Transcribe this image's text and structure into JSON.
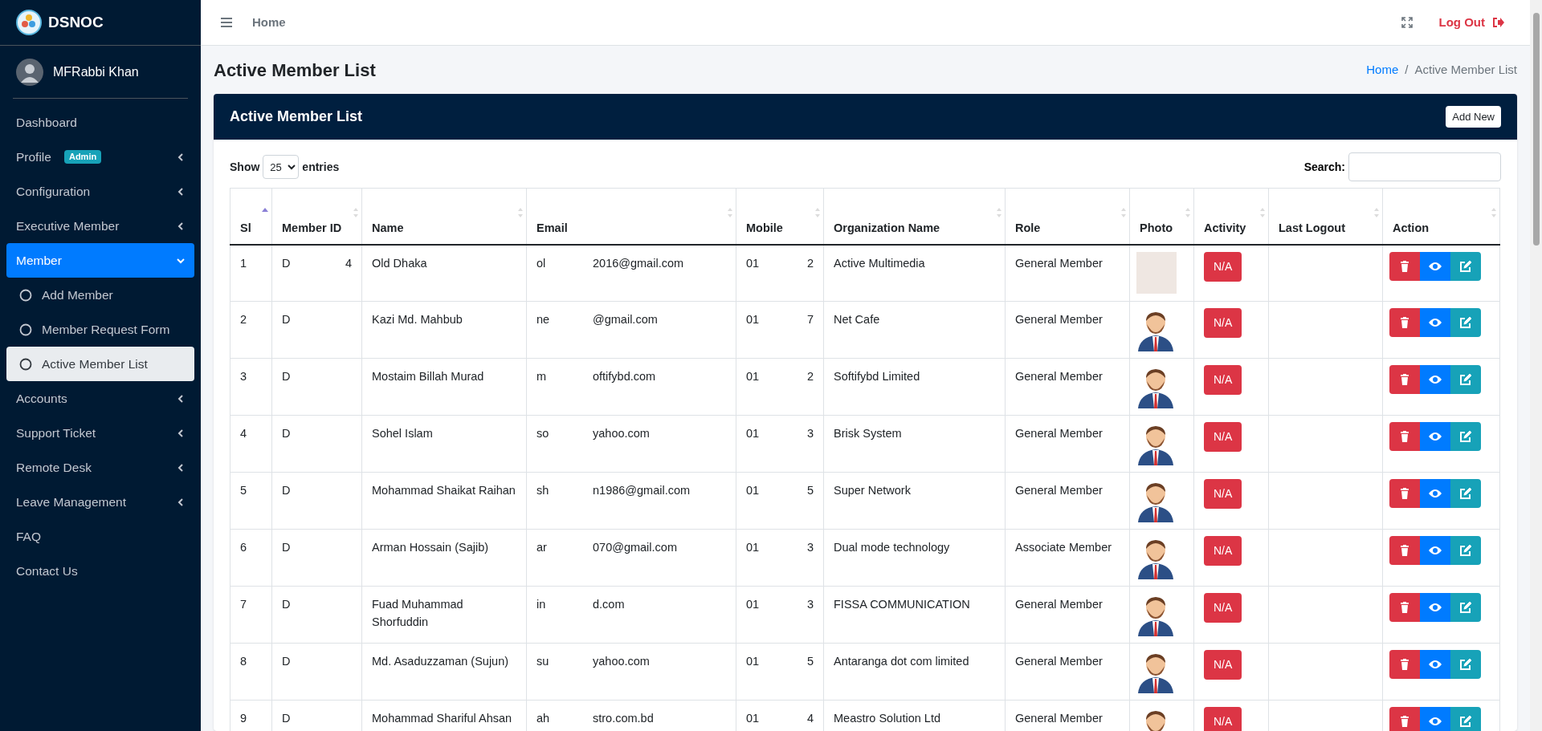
{
  "brand": {
    "name": "DSNOC"
  },
  "user": {
    "name": "MFRabbi Khan"
  },
  "sidebar": {
    "items": [
      {
        "label": "Dashboard",
        "kind": "link",
        "selected": false
      },
      {
        "label": "Profile",
        "kind": "menu",
        "badge": "Admin",
        "expanded": false,
        "selected": false
      },
      {
        "label": "Configuration",
        "kind": "menu",
        "expanded": false,
        "selected": false
      },
      {
        "label": "Executive Member",
        "kind": "menu",
        "expanded": false,
        "selected": false
      },
      {
        "label": "Member",
        "kind": "menu",
        "expanded": true,
        "selected": true,
        "children": [
          {
            "label": "Add Member",
            "selected": false
          },
          {
            "label": "Member Request Form",
            "selected": false
          },
          {
            "label": "Active Member List",
            "selected": true
          }
        ]
      },
      {
        "label": "Accounts",
        "kind": "menu",
        "expanded": false,
        "selected": false
      },
      {
        "label": "Support Ticket",
        "kind": "menu",
        "expanded": false,
        "selected": false
      },
      {
        "label": "Remote Desk",
        "kind": "menu",
        "expanded": false,
        "selected": false
      },
      {
        "label": "Leave Management",
        "kind": "menu",
        "expanded": false,
        "selected": false
      },
      {
        "label": "FAQ",
        "kind": "link",
        "selected": false
      },
      {
        "label": "Contact Us",
        "kind": "link",
        "selected": false
      }
    ]
  },
  "navbar": {
    "home": "Home",
    "logout": "Log Out"
  },
  "page": {
    "title": "Active Member List",
    "breadcrumb": [
      {
        "label": "Home",
        "kind": "link"
      },
      {
        "label": "Active Member List",
        "kind": "current"
      }
    ],
    "breadcrumb_separator": "/"
  },
  "card": {
    "title": "Active Member List",
    "add_button": "Add New",
    "show_label": "Show",
    "page_size": "25",
    "entries_label": "entries",
    "search_label": "Search:",
    "table": {
      "columns": [
        {
          "label": "Sl",
          "sorted": true
        },
        {
          "label": "Member ID",
          "sorted": false
        },
        {
          "label": "Name",
          "sorted": false
        },
        {
          "label": "Email",
          "sorted": false
        },
        {
          "label": "Mobile",
          "sorted": false
        },
        {
          "label": "Organization Name",
          "sorted": false
        },
        {
          "label": "Role",
          "sorted": false
        },
        {
          "label": "Photo",
          "sorted": false
        },
        {
          "label": "Activity",
          "sorted": false
        },
        {
          "label": "Last Logout",
          "sorted": false
        },
        {
          "label": "Action",
          "sorted": false
        }
      ],
      "rows": [
        {
          "sl": "1",
          "member_id": [
            "D",
            "4"
          ],
          "name": "Old Dhaka",
          "email": [
            "ol",
            "2016@gmail.com"
          ],
          "mobile": [
            "01",
            "2"
          ],
          "organization": "Active Multimedia",
          "role": "General Member",
          "kind": "photo",
          "activity": "N/A"
        },
        {
          "sl": "2",
          "member_id": [
            "D"
          ],
          "name": "Kazi Md. Mahbub",
          "email": [
            "ne",
            "@gmail.com"
          ],
          "mobile": [
            "01",
            "7"
          ],
          "organization": "Net Cafe",
          "role": "General Member",
          "kind": "avatar",
          "activity": "N/A"
        },
        {
          "sl": "3",
          "member_id": [
            "D"
          ],
          "name": "Mostaim Billah Murad",
          "email": [
            "m",
            "oftifybd.com"
          ],
          "mobile": [
            "01",
            "2"
          ],
          "organization": "Softifybd Limited",
          "role": "General Member",
          "kind": "avatar",
          "activity": "N/A"
        },
        {
          "sl": "4",
          "member_id": [
            "D"
          ],
          "name": "Sohel Islam",
          "email": [
            "so",
            "yahoo.com"
          ],
          "mobile": [
            "01",
            "3"
          ],
          "organization": "Brisk System",
          "role": "General Member",
          "kind": "avatar",
          "activity": "N/A"
        },
        {
          "sl": "5",
          "member_id": [
            "D"
          ],
          "name": "Mohammad Shaikat Raihan",
          "email": [
            "sh",
            "n1986@gmail.com"
          ],
          "mobile": [
            "01",
            "5"
          ],
          "organization": "Super Network",
          "role": "General Member",
          "kind": "avatar",
          "activity": "N/A"
        },
        {
          "sl": "6",
          "member_id": [
            "D"
          ],
          "name": "Arman Hossain (Sajib)",
          "email": [
            "ar",
            "070@gmail.com"
          ],
          "mobile": [
            "01",
            "3"
          ],
          "organization": "Dual mode technology",
          "role": "Associate Member",
          "kind": "avatar",
          "activity": "N/A"
        },
        {
          "sl": "7",
          "member_id": [
            "D"
          ],
          "name": "Fuad Muhammad Shorfuddin",
          "email": [
            "in",
            "d.com"
          ],
          "mobile": [
            "01",
            "3"
          ],
          "organization": "FISSA COMMUNICATION",
          "role": "General Member",
          "kind": "avatar",
          "activity": "N/A"
        },
        {
          "sl": "8",
          "member_id": [
            "D"
          ],
          "name": "Md. Asaduzzaman (Sujun)",
          "email": [
            "su",
            "yahoo.com"
          ],
          "mobile": [
            "01",
            "5"
          ],
          "organization": "Antaranga dot com limited",
          "role": "General Member",
          "kind": "avatar",
          "activity": "N/A"
        },
        {
          "sl": "9",
          "member_id": [
            "D"
          ],
          "name": "Mohammad Shariful Ahsan",
          "email": [
            "ah",
            "stro.com.bd"
          ],
          "mobile": [
            "01",
            "4"
          ],
          "organization": "Meastro Solution Ltd",
          "role": "General Member",
          "kind": "avatar",
          "activity": "N/A"
        }
      ]
    }
  }
}
